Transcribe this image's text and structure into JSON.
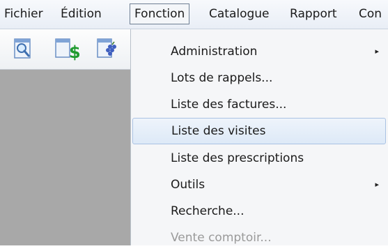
{
  "menubar": {
    "items": [
      {
        "label": "Fichier",
        "open": false
      },
      {
        "label": "Édition",
        "open": false
      },
      {
        "label": "Fonction",
        "open": true
      },
      {
        "label": "Catalogue",
        "open": false
      },
      {
        "label": "Rapport",
        "open": false
      },
      {
        "label": "Con",
        "open": false
      }
    ]
  },
  "toolbar": {
    "buttons": [
      {
        "icon": "magnifier-document-icon"
      },
      {
        "icon": "dollar-document-icon"
      },
      {
        "icon": "grapes-document-icon"
      }
    ]
  },
  "dropdown": {
    "items": [
      {
        "label": "Administration",
        "submenu": true,
        "state": "normal"
      },
      {
        "label": "Lots de rappels...",
        "submenu": false,
        "state": "normal"
      },
      {
        "label": "Liste des factures...",
        "submenu": false,
        "state": "normal"
      },
      {
        "label": "Liste des visites",
        "submenu": false,
        "state": "highlighted"
      },
      {
        "label": "Liste des prescriptions",
        "submenu": false,
        "state": "normal"
      },
      {
        "label": "Outils",
        "submenu": true,
        "state": "normal"
      },
      {
        "label": "Recherche...",
        "submenu": false,
        "state": "normal"
      },
      {
        "label": "Vente comptoir...",
        "submenu": false,
        "state": "disabled"
      }
    ],
    "submenu_arrow": "▸"
  },
  "colors": {
    "highlight_border": "#a9c2e3",
    "panel_gray": "#a8a8a8",
    "disabled_text": "#9a9a9a"
  }
}
